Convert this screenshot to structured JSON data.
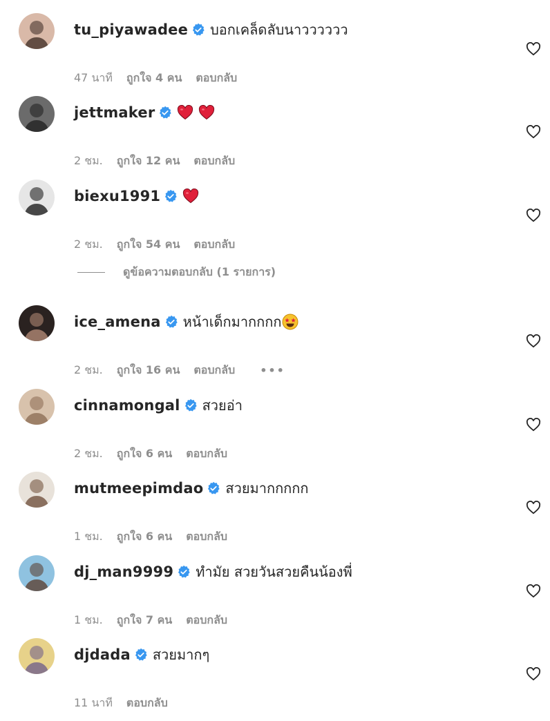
{
  "comments": [
    {
      "username": "tu_piyawadee",
      "text": "บอกเคล็ดลับนาวววววว",
      "emoji": [],
      "time": "47 นาที",
      "likes": "ถูกใจ 4 คน",
      "reply": "ตอบกลับ",
      "avatar_color": "#d9b9a8",
      "avatar_accent": "#3a2a22"
    },
    {
      "username": "jettmaker",
      "text": "",
      "emoji": [
        "red-heart",
        "red-heart"
      ],
      "time": "2 ชม.",
      "likes": "ถูกใจ 12 คน",
      "reply": "ตอบกลับ",
      "avatar_color": "#6b6b6b",
      "avatar_accent": "#1e1e1e"
    },
    {
      "username": "biexu1991",
      "text": "",
      "emoji": [
        "red-heart"
      ],
      "time": "2 ชม.",
      "likes": "ถูกใจ 54 คน",
      "reply": "ตอบกลับ",
      "avatar_color": "#e6e6e6",
      "avatar_accent": "#111111"
    },
    {
      "username": "ice_amena",
      "text": "หน้าเด็กมากกกก",
      "emoji": [
        "star-struck"
      ],
      "time": "2 ชม.",
      "likes": "ถูกใจ 16 คน",
      "reply": "ตอบกลับ",
      "more": "•••",
      "avatar_color": "#2a2220",
      "avatar_accent": "#b98f7a"
    },
    {
      "username": "cinnamongal",
      "text": "สวยอ่า",
      "emoji": [],
      "time": "2 ชม.",
      "likes": "ถูกใจ 6 คน",
      "reply": "ตอบกลับ",
      "avatar_color": "#d8c2ac",
      "avatar_accent": "#8a6a52"
    },
    {
      "username": "mutmeepimdao",
      "text": "สวยมากกกกก",
      "emoji": [],
      "time": "1 ชม.",
      "likes": "ถูกใจ 6 คน",
      "reply": "ตอบกลับ",
      "avatar_color": "#e8e2da",
      "avatar_accent": "#6b4a35"
    },
    {
      "username": "dj_man9999",
      "text": "ทำมัย สวยวันสวยคืนน้องพี่",
      "emoji": [],
      "time": "1 ชม.",
      "likes": "ถูกใจ 7 คน",
      "reply": "ตอบกลับ",
      "avatar_color": "#8fc2e0",
      "avatar_accent": "#5a3a2a"
    },
    {
      "username": "djdada",
      "text": "สวยมากๆ",
      "emoji": [],
      "time": "11 นาที",
      "likes": "",
      "reply": "ตอบกลับ",
      "avatar_color": "#e7d28a",
      "avatar_accent": "#6b5a8a"
    }
  ],
  "view_replies": "ดูข้อความตอบกลับ (1 รายการ)",
  "colors": {
    "verified": "#3897f0",
    "muted": "#8e8e8e",
    "heart": "#e0203a",
    "text": "#262626"
  },
  "icons": {
    "like": "heart-outline-icon",
    "verified": "verified-badge-icon",
    "more": "more-options-icon"
  }
}
